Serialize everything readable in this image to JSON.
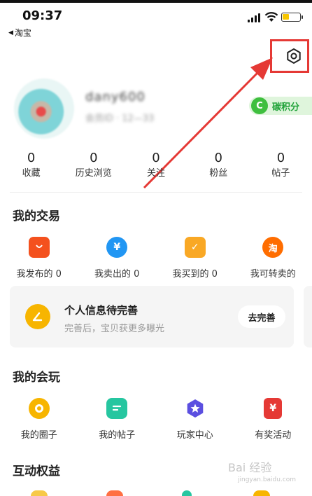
{
  "status_bar": {
    "time": "09:37",
    "back_app": "淘宝"
  },
  "profile": {
    "username": "dany600",
    "subtitle": "会员ID · 12—33",
    "carbon_badge": {
      "icon_letter": "C",
      "label": "碳积分"
    }
  },
  "stats": [
    {
      "value": "0",
      "label": "收藏"
    },
    {
      "value": "0",
      "label": "历史浏览"
    },
    {
      "value": "0",
      "label": "关注"
    },
    {
      "value": "0",
      "label": "粉丝"
    },
    {
      "value": "0",
      "label": "帖子"
    }
  ],
  "trade": {
    "title": "我的交易",
    "items": [
      {
        "label": "我发布的 0",
        "icon": "shopping-bag-icon",
        "color": "#f4511e",
        "glyph": ""
      },
      {
        "label": "我卖出的 0",
        "icon": "yen-icon",
        "color": "#2196f3",
        "glyph": "¥"
      },
      {
        "label": "我买到的 0",
        "icon": "checklist-icon",
        "color": "#f9a825",
        "glyph": "✓"
      },
      {
        "label": "我可转卖的",
        "icon": "taobao-icon",
        "color": "#ff6d00",
        "glyph": "淘"
      }
    ]
  },
  "info_card": {
    "title": "个人信息待完善",
    "subtitle": "完善后，宝贝获更多曝光",
    "button": "去完善"
  },
  "play": {
    "title": "我的会玩",
    "items": [
      {
        "label": "我的圈子",
        "icon": "circle-icon",
        "color": "#f7b500"
      },
      {
        "label": "我的帖子",
        "icon": "post-icon",
        "color": "#26c6a0"
      },
      {
        "label": "玩家中心",
        "icon": "star-badge-icon",
        "color": "#5b4fe0"
      },
      {
        "label": "有奖活动",
        "icon": "red-packet-icon",
        "color": "#e53935",
        "glyph": "¥"
      }
    ]
  },
  "rights": {
    "title": "互动权益"
  },
  "watermark": {
    "text": "Bai 经验",
    "sub": "jingyan.baidu.com"
  }
}
